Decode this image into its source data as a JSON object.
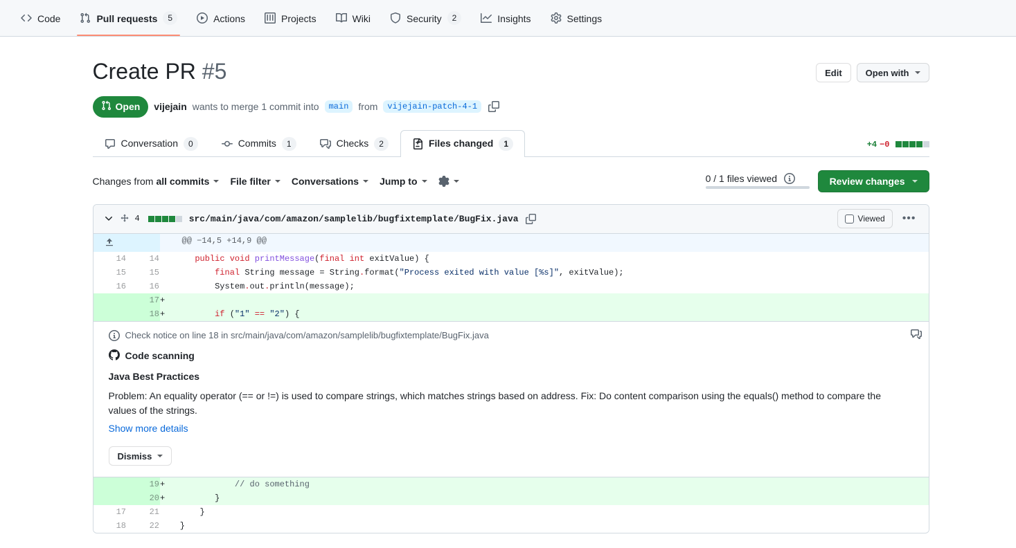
{
  "repo_nav": {
    "items": [
      {
        "label": "Code",
        "icon": "code-icon",
        "count": null,
        "selected": false
      },
      {
        "label": "Pull requests",
        "icon": "git-pull-request-icon",
        "count": "5",
        "selected": true
      },
      {
        "label": "Actions",
        "icon": "play-icon",
        "count": null,
        "selected": false
      },
      {
        "label": "Projects",
        "icon": "table-icon",
        "count": null,
        "selected": false
      },
      {
        "label": "Wiki",
        "icon": "book-icon",
        "count": null,
        "selected": false
      },
      {
        "label": "Security",
        "icon": "shield-icon",
        "count": "2",
        "selected": false
      },
      {
        "label": "Insights",
        "icon": "graph-icon",
        "count": null,
        "selected": false
      },
      {
        "label": "Settings",
        "icon": "gear-icon",
        "count": null,
        "selected": false
      }
    ]
  },
  "pr": {
    "title": "Create PR",
    "number": "#5",
    "state": "Open",
    "author": "vijejain",
    "merge_text": "wants to merge 1 commit into",
    "base_branch": "main",
    "from_text": "from",
    "head_branch": "vijejain-patch-4-1",
    "edit_label": "Edit",
    "open_with_label": "Open with"
  },
  "tabs": [
    {
      "label": "Conversation",
      "count": "0",
      "icon": "comment-icon",
      "selected": false
    },
    {
      "label": "Commits",
      "count": "1",
      "icon": "commit-icon",
      "selected": false
    },
    {
      "label": "Checks",
      "count": "2",
      "icon": "checklist-icon",
      "selected": false
    },
    {
      "label": "Files changed",
      "count": "1",
      "icon": "file-diff-icon",
      "selected": true
    }
  ],
  "diffstat": {
    "additions": "+4",
    "deletions": "−0",
    "blocks": [
      "green",
      "green",
      "green",
      "green",
      "neutral"
    ]
  },
  "toolbar": {
    "changes_from_prefix": "Changes from",
    "changes_from_value": "all commits",
    "file_filter": "File filter",
    "conversations": "Conversations",
    "jump_to": "Jump to",
    "settings_icon": "gear-icon",
    "files_viewed": "0 / 1 files viewed",
    "viewed_progress_pct": "0",
    "review_changes": "Review changes"
  },
  "file": {
    "change_count": "4",
    "blocks": [
      "green",
      "green",
      "green",
      "green",
      "neutral"
    ],
    "path": "src/main/java/com/amazon/samplelib/bugfixtemplate/BugFix.java",
    "copy_icon": "copy-icon",
    "viewed_label": "Viewed",
    "kebab_label": "•••"
  },
  "diff": {
    "hunk": "@@ −14,5 +14,9 @@",
    "rows": [
      {
        "type": "hunk",
        "old": "",
        "new": "",
        "marker": "",
        "tokens": [
          {
            "t": "@@ −14,5 +14,9 @@",
            "c": "tok-n"
          }
        ]
      },
      {
        "type": "ctx",
        "old": "14",
        "new": "14",
        "marker": "",
        "tokens": [
          {
            "t": "    ",
            "c": "tok-n"
          },
          {
            "t": "public",
            "c": "tok-k"
          },
          {
            "t": " ",
            "c": "tok-n"
          },
          {
            "t": "void",
            "c": "tok-k"
          },
          {
            "t": " ",
            "c": "tok-n"
          },
          {
            "t": "printMessage",
            "c": "tok-f"
          },
          {
            "t": "(",
            "c": "tok-n"
          },
          {
            "t": "final",
            "c": "tok-k"
          },
          {
            "t": " ",
            "c": "tok-n"
          },
          {
            "t": "int",
            "c": "tok-k"
          },
          {
            "t": " exitValue) {",
            "c": "tok-n"
          }
        ]
      },
      {
        "type": "ctx",
        "old": "15",
        "new": "15",
        "marker": "",
        "tokens": [
          {
            "t": "        ",
            "c": "tok-n"
          },
          {
            "t": "final",
            "c": "tok-k"
          },
          {
            "t": " String message = String",
            "c": "tok-n"
          },
          {
            "t": ".",
            "c": "tok-k"
          },
          {
            "t": "format(",
            "c": "tok-n"
          },
          {
            "t": "\"Process exited with value [%s]\"",
            "c": "tok-s"
          },
          {
            "t": ", exitValue);",
            "c": "tok-n"
          }
        ]
      },
      {
        "type": "ctx",
        "old": "16",
        "new": "16",
        "marker": "",
        "tokens": [
          {
            "t": "        System",
            "c": "tok-n"
          },
          {
            "t": ".",
            "c": "tok-k"
          },
          {
            "t": "out",
            "c": "tok-n"
          },
          {
            "t": ".",
            "c": "tok-k"
          },
          {
            "t": "println(message);",
            "c": "tok-n"
          }
        ]
      },
      {
        "type": "add",
        "old": "",
        "new": "17",
        "marker": "+",
        "tokens": [
          {
            "t": "",
            "c": "tok-n"
          }
        ]
      },
      {
        "type": "add",
        "old": "",
        "new": "18",
        "marker": "+",
        "tokens": [
          {
            "t": "        ",
            "c": "tok-n"
          },
          {
            "t": "if",
            "c": "tok-k"
          },
          {
            "t": " (",
            "c": "tok-n"
          },
          {
            "t": "\"1\"",
            "c": "tok-s"
          },
          {
            "t": " ",
            "c": "tok-n"
          },
          {
            "t": "==",
            "c": "tok-k"
          },
          {
            "t": " ",
            "c": "tok-n"
          },
          {
            "t": "\"2\"",
            "c": "tok-s"
          },
          {
            "t": ") {",
            "c": "tok-n"
          }
        ]
      }
    ],
    "rows_after": [
      {
        "type": "add",
        "old": "",
        "new": "19",
        "marker": "+",
        "tokens": [
          {
            "t": "            ",
            "c": "tok-n"
          },
          {
            "t": "// do something",
            "c": "tok-c"
          }
        ]
      },
      {
        "type": "add",
        "old": "",
        "new": "20",
        "marker": "+",
        "tokens": [
          {
            "t": "        }",
            "c": "tok-n"
          }
        ]
      },
      {
        "type": "ctx",
        "old": "17",
        "new": "21",
        "marker": "",
        "tokens": [
          {
            "t": "     }",
            "c": "tok-n"
          }
        ]
      },
      {
        "type": "ctx",
        "old": "18",
        "new": "22",
        "marker": "",
        "tokens": [
          {
            "t": " }",
            "c": "tok-n"
          }
        ]
      }
    ]
  },
  "annotation": {
    "header": "Check notice on line 18 in src/main/java/com/amazon/samplelib/bugfixtemplate/BugFix.java",
    "tool": "Code scanning",
    "rule": "Java Best Practices",
    "body": "Problem: An equality operator (== or !=) is used to compare strings, which matches strings based on address. Fix: Do content comparison using the equals() method to compare the values of the strings.",
    "more_link": "Show more details",
    "dismiss_label": "Dismiss",
    "side_icon": "checks-report-icon",
    "info_icon": "info-icon"
  }
}
